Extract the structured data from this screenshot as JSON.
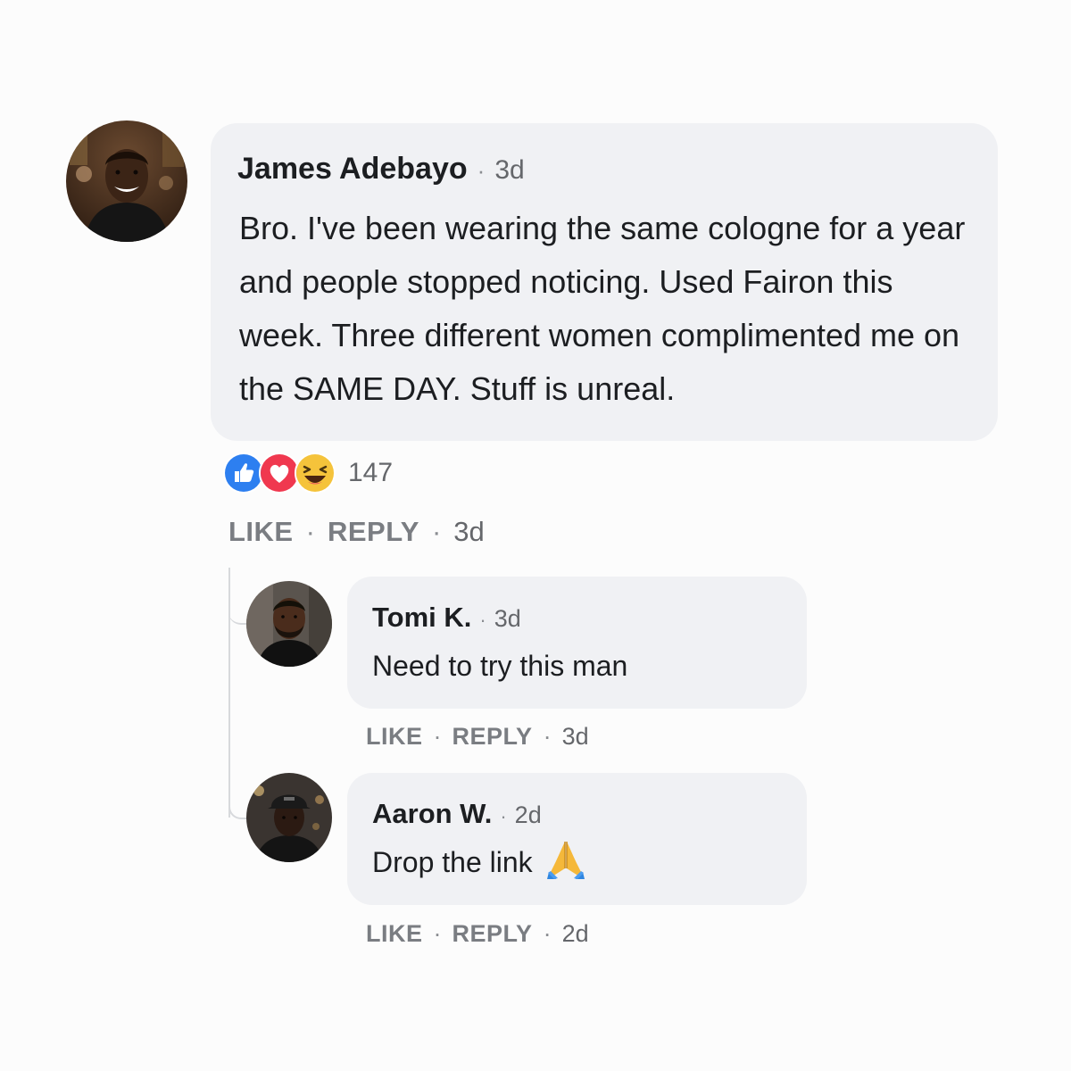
{
  "main_comment": {
    "author": "James Adebayo",
    "separator": "·",
    "time": "3d",
    "text": "Bro. I've been wearing the same cologne for a year and people stopped noticing. Used Fairon this week. Three different women complimented me on the SAME DAY. Stuff is unreal.",
    "reactions": {
      "icons": [
        "like-icon",
        "love-icon",
        "haha-icon"
      ],
      "count": "147"
    },
    "actions": {
      "like": "LIKE",
      "reply": "REPLY",
      "separator": "·",
      "time": "3d"
    }
  },
  "replies": [
    {
      "author": "Tomi K.",
      "separator": "·",
      "time": "3d",
      "text": "Need to try this man",
      "actions": {
        "like": "LIKE",
        "reply": "REPLY",
        "separator": "·",
        "time": "3d"
      }
    },
    {
      "author": "Aaron W.",
      "separator": "·",
      "time": "2d",
      "text": "Drop the link",
      "emoji": "folded-hands-icon",
      "actions": {
        "like": "LIKE",
        "reply": "REPLY",
        "separator": "·",
        "time": "2d"
      }
    }
  ],
  "colors": {
    "bubble": "#f0f1f4",
    "like_blue": "#1877f2",
    "love_red": "#f33e58",
    "haha_yellow": "#f7b125",
    "meta_gray": "#65676b"
  }
}
